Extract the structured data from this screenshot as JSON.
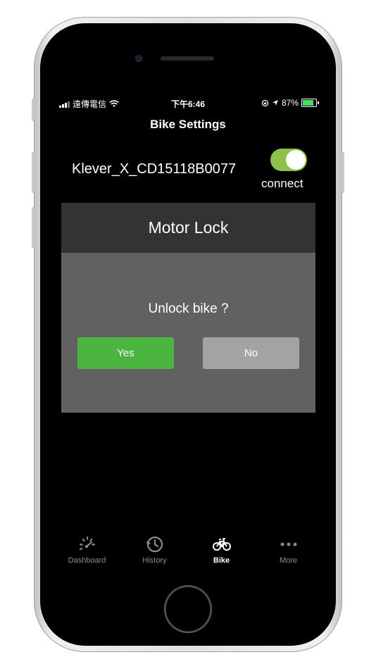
{
  "status_bar": {
    "carrier": "遠傳電信",
    "time": "下午6:46",
    "battery": "87%",
    "battery_level": 0.87
  },
  "header": {
    "title": "Bike Settings"
  },
  "device": {
    "name": "Klever_X_CD15118B0077",
    "toggle_on": true,
    "connect_label": "connect"
  },
  "modal": {
    "title": "Motor Lock",
    "question": "Unlock bike ?",
    "yes_label": "Yes",
    "no_label": "No"
  },
  "tabbar": {
    "items": [
      {
        "label": "Dashboard",
        "icon": "speedometer-icon"
      },
      {
        "label": "History",
        "icon": "clock-icon"
      },
      {
        "label": "Bike",
        "icon": "bicycle-icon"
      },
      {
        "label": "More",
        "icon": "ellipsis-icon"
      }
    ]
  },
  "colors": {
    "toggle": "#8bc34a",
    "yes_button": "#4cb540",
    "no_button": "#a3a3a3",
    "modal_header": "#333333",
    "modal_body": "#616161"
  }
}
